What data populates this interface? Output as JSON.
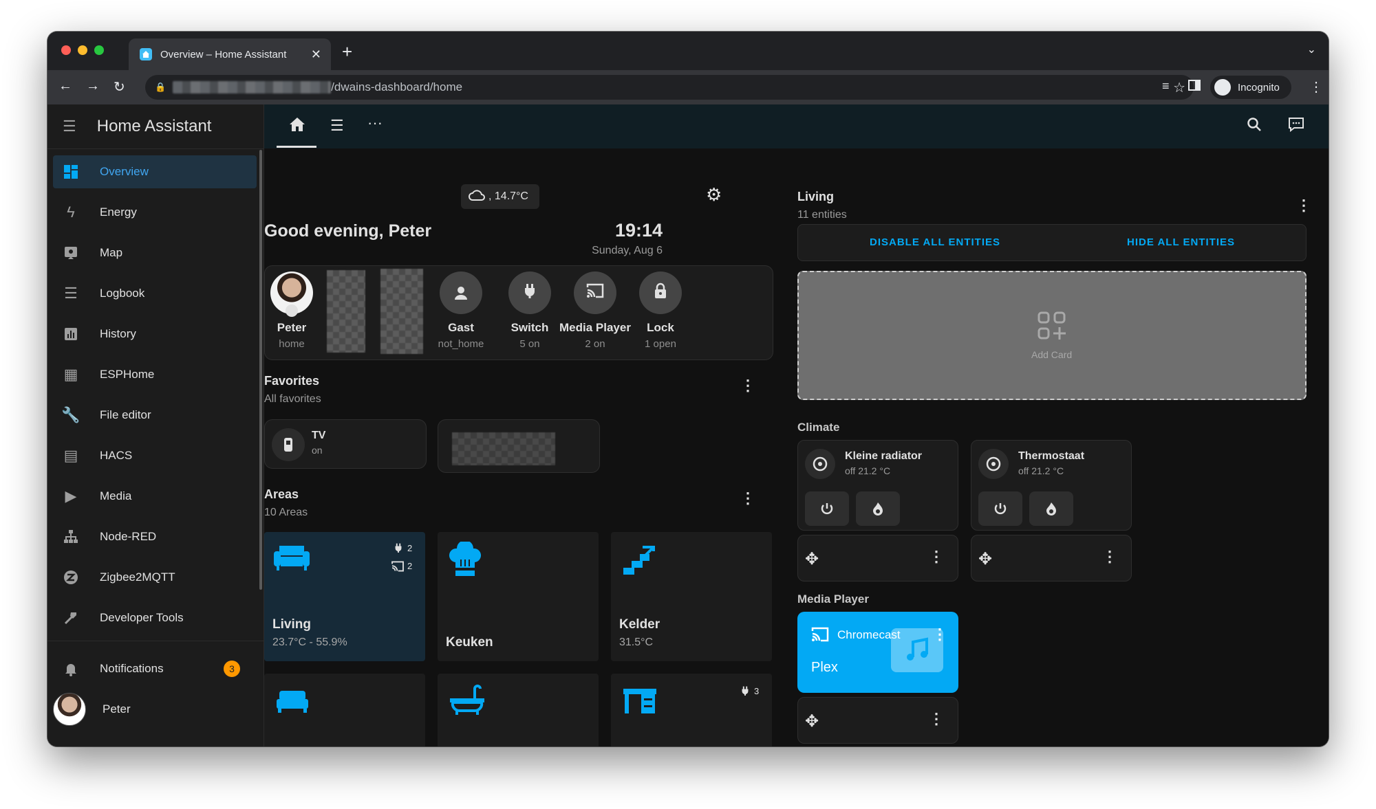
{
  "browser": {
    "tab_title": "Overview – Home Assistant",
    "url_path": "/dwains-dashboard/home",
    "incognito_label": "Incognito"
  },
  "sidebar": {
    "title": "Home Assistant",
    "items": [
      {
        "label": "Overview",
        "icon": "dashboard-icon",
        "active": true
      },
      {
        "label": "Energy",
        "icon": "lightning-icon"
      },
      {
        "label": "Map",
        "icon": "map-icon"
      },
      {
        "label": "Logbook",
        "icon": "list-icon"
      },
      {
        "label": "History",
        "icon": "chart-icon"
      },
      {
        "label": "ESPHome",
        "icon": "chip-icon"
      },
      {
        "label": "File editor",
        "icon": "wrench-icon"
      },
      {
        "label": "HACS",
        "icon": "hacs-icon"
      },
      {
        "label": "Media",
        "icon": "play-icon"
      },
      {
        "label": "Node-RED",
        "icon": "sitemap-icon"
      },
      {
        "label": "Zigbee2MQTT",
        "icon": "zigbee-icon"
      },
      {
        "label": "Developer Tools",
        "icon": "hammer-icon"
      }
    ],
    "notifications_label": "Notifications",
    "notifications_count": "3",
    "user_name": "Peter"
  },
  "header": {
    "weather": ", 14.7°C",
    "greeting": "Good evening, Peter",
    "time": "19:14",
    "date": "Sunday, Aug 6"
  },
  "persons": [
    {
      "name": "Peter",
      "state": "home"
    },
    {
      "name": "Gast",
      "state": "not_home"
    },
    {
      "name": "Switch",
      "state": "5 on"
    },
    {
      "name": "Media Player",
      "state": "2 on"
    },
    {
      "name": "Lock",
      "state": "1 open"
    }
  ],
  "favorites": {
    "title": "Favorites",
    "subtitle": "All favorites",
    "items": [
      {
        "name": "TV",
        "state": "on"
      }
    ]
  },
  "areas": {
    "title": "Areas",
    "subtitle": "10 Areas",
    "items": [
      {
        "name": "Living",
        "value": "23.7°C - 55.9%",
        "badge1": "2",
        "badge2": "2"
      },
      {
        "name": "Keuken",
        "value": ""
      },
      {
        "name": "Kelder",
        "value": "31.5°C"
      },
      {
        "badge": "3"
      }
    ]
  },
  "living": {
    "title": "Living",
    "subtitle": "11 entities",
    "disable_all": "DISABLE ALL ENTITIES",
    "hide_all": "HIDE ALL ENTITIES",
    "add_card": "Add Card"
  },
  "climate": {
    "title": "Climate",
    "items": [
      {
        "name": "Kleine radiator",
        "state": "off 21.2 °C"
      },
      {
        "name": "Thermostaat",
        "state": "off 21.2 °C"
      }
    ]
  },
  "media": {
    "title": "Media Player",
    "device": "Chromecast",
    "source": "Plex"
  },
  "colors": {
    "accent": "#03a9f4",
    "badge": "#ff9800",
    "background": "#111111",
    "card": "#1c1c1c"
  }
}
